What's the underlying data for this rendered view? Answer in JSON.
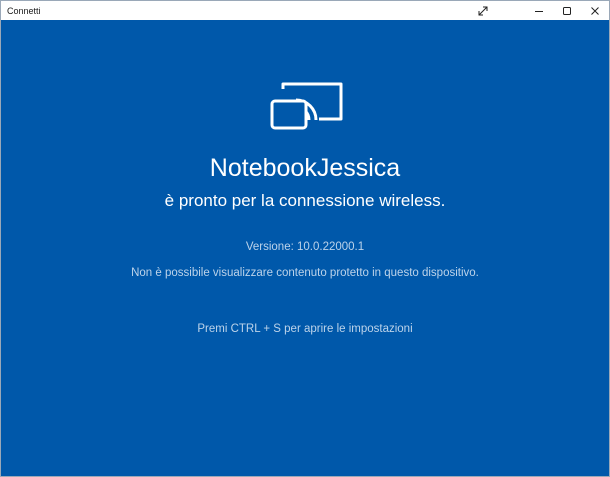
{
  "window": {
    "title": "Connetti",
    "controls": {
      "fullscreen_icon": "expand-diagonal-icon",
      "minimize_icon": "minimize-icon",
      "maximize_icon": "maximize-icon",
      "close_icon": "close-icon"
    }
  },
  "main": {
    "icon": "wireless-cast-icon",
    "device_name": "NotebookJessica",
    "ready_text": "è pronto per la connessione wireless.",
    "version": "Versione: 10.0.22000.1",
    "protected_note": "Non è possibile visualizzare contenuto protetto in questo dispositivo.",
    "settings_hint": "Premi CTRL + S per aprire le impostazioni"
  },
  "colors": {
    "background": "#0058aa",
    "primary_text": "#ffffff",
    "secondary_text": "#bcd3ea"
  }
}
